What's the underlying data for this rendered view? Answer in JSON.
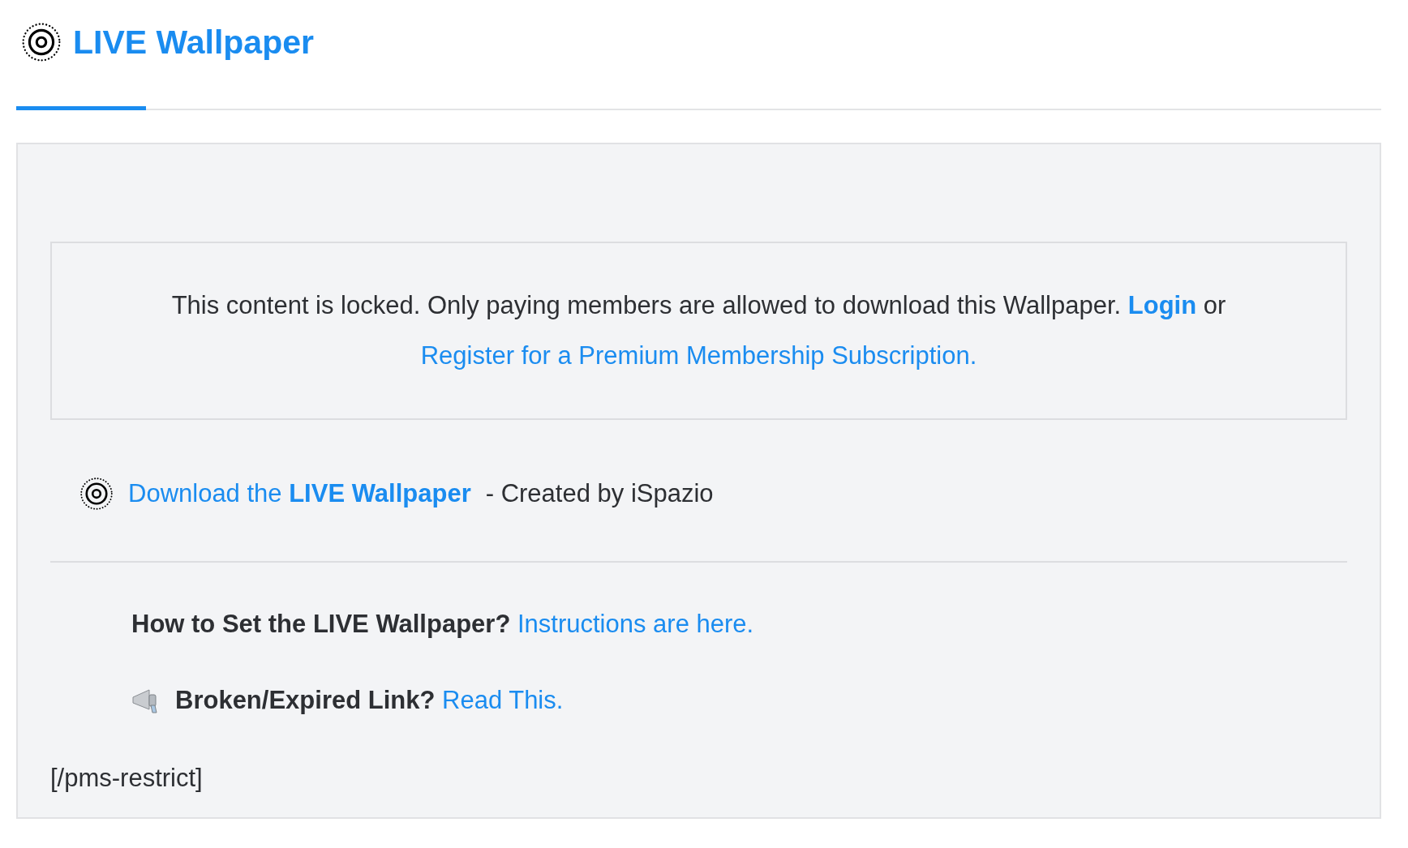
{
  "header": {
    "title": "LIVE Wallpaper"
  },
  "notice": {
    "text": "This content is locked. Only paying members are allowed to download this Wallpaper.",
    "login_link": "Login",
    "joiner": "or",
    "register_link": "Register for a Premium Membership Subscription."
  },
  "download": {
    "link": "Download the **LIVE Wallpaper**",
    "credit": "- Created by iSpazio"
  },
  "help": [
    {
      "kind": "plain",
      "question": "How to Set the LIVE Wallpaper?",
      "link": "Instructions are here."
    },
    {
      "kind": "megaphone",
      "question": "Broken/Expired Link?",
      "link": "Read This."
    }
  ],
  "footer_code": "[/pms-restrict]"
}
